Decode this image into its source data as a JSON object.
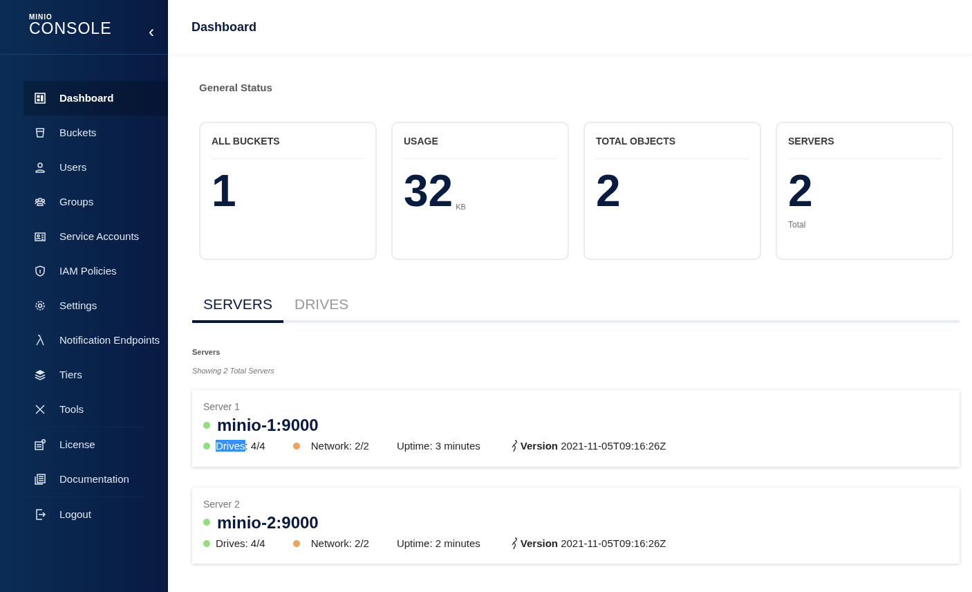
{
  "logo": {
    "brand": "MINIO",
    "product": "CONSOLE"
  },
  "sidebar": {
    "collapse_icon": "‹",
    "groups": [
      [
        {
          "label": "Dashboard",
          "selected": true
        },
        {
          "label": "Buckets",
          "selected": false
        },
        {
          "label": "Users",
          "selected": false
        },
        {
          "label": "Groups",
          "selected": false
        },
        {
          "label": "Service Accounts",
          "selected": false
        },
        {
          "label": "IAM Policies",
          "selected": false
        },
        {
          "label": "Settings",
          "selected": false
        },
        {
          "label": "Notification Endpoints",
          "selected": false
        },
        {
          "label": "Tiers",
          "selected": false
        },
        {
          "label": "Tools",
          "selected": false
        }
      ],
      [
        {
          "label": "License",
          "selected": false
        },
        {
          "label": "Documentation",
          "selected": false
        }
      ],
      [
        {
          "label": "Logout",
          "selected": false
        }
      ]
    ]
  },
  "header": {
    "title": "Dashboard"
  },
  "general_status": {
    "title": "General Status",
    "cards": [
      {
        "title": "ALL BUCKETS",
        "value": "1"
      },
      {
        "title": "USAGE",
        "value": "32",
        "unit": "KB"
      },
      {
        "title": "TOTAL OBJECTS",
        "value": "2"
      },
      {
        "title": "SERVERS",
        "value": "2",
        "caption": "Total"
      }
    ]
  },
  "tabs": [
    {
      "label": "SERVERS",
      "selected": true
    },
    {
      "label": "DRIVES",
      "selected": false
    }
  ],
  "servers_section": {
    "title": "Servers",
    "subtitle": "Showing 2 Total Servers",
    "servers": [
      {
        "label": "Server 1",
        "name": "minio-1:9000",
        "color": "#8ee07a",
        "drives": {
          "label": "Drives",
          "value": ": 4/4",
          "color": "#8ee07a",
          "highlighted": true
        },
        "network": {
          "text": "Network: 2/2",
          "color": "#f2a15c"
        },
        "uptime": "Uptime: 3 minutes",
        "version_label": "Version",
        "version": "2021-11-05T09:16:26Z"
      },
      {
        "label": "Server 2",
        "name": "minio-2:9000",
        "color": "#8ee07a",
        "drives": {
          "label": "Drives",
          "value": ": 4/4",
          "color": "#8ee07a",
          "highlighted": false
        },
        "network": {
          "text": "Network: 2/2",
          "color": "#f2a15c"
        },
        "uptime": "Uptime: 2 minutes",
        "version_label": "Version",
        "version": "2021-11-05T09:16:26Z"
      }
    ]
  }
}
